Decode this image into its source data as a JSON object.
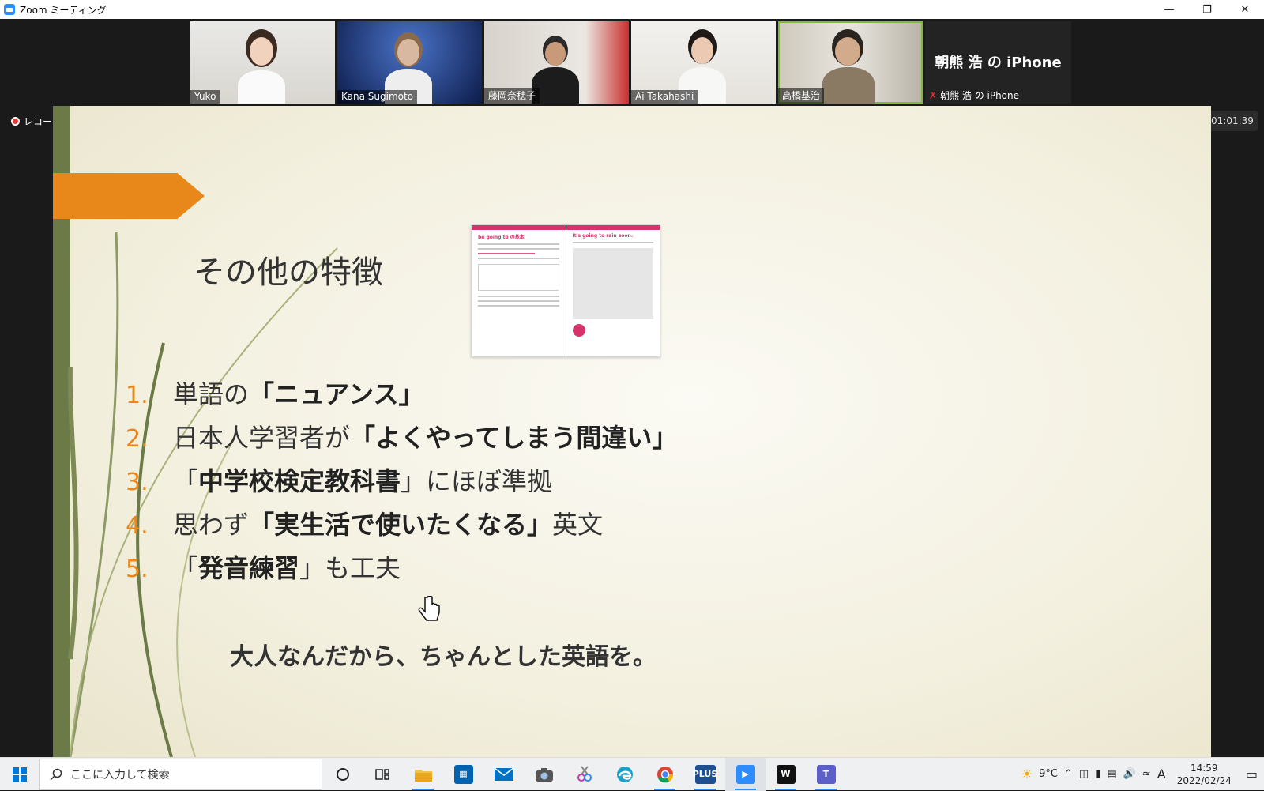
{
  "window": {
    "title": "Zoom ミーティング"
  },
  "participants": [
    {
      "name": "Yuko"
    },
    {
      "name": "Kana Sugimoto"
    },
    {
      "name": "藤岡奈穂子"
    },
    {
      "name": "Ai Takahashi"
    },
    {
      "name": "高橋基治",
      "active": true
    }
  ],
  "no_video_participant": {
    "display_name": "朝熊 浩 の iPhone",
    "label": "朝熊 浩 の iPhone"
  },
  "recording": {
    "label": "レコーディング中"
  },
  "timer": "01:01:39",
  "slide": {
    "title": "その他の特徴",
    "items": [
      {
        "num": "1.",
        "pre": "単語の",
        "bold": "「ニュアンス」",
        "post": ""
      },
      {
        "num": "2.",
        "pre": "日本人学習者が",
        "bold": "「よくやってしまう間違い」",
        "post": ""
      },
      {
        "num": "3.",
        "pre": "「",
        "bold": "中学校検定教科書",
        "post": "」にほぼ準拠"
      },
      {
        "num": "4.",
        "pre": "思わず",
        "bold": "「実生活で使いたくなる」",
        "post": "英文"
      },
      {
        "num": "5.",
        "pre": "「",
        "bold": "発音練習",
        "post": "」も工夫"
      }
    ],
    "slogan": "大人なんだから、ちゃんとした英語を。",
    "book": {
      "left_heading": "be going to の基本",
      "right_heading": "It's going to rain soon."
    }
  },
  "taskbar": {
    "search_placeholder": "ここに入力して検索",
    "weather": "9°C",
    "time": "14:59",
    "date": "2022/02/24",
    "ime": "A"
  },
  "colors": {
    "accent_orange": "#e8881a",
    "zoom_blue": "#2d8cff",
    "active_speaker": "#7fb842",
    "bar_green": "#6b7a47"
  }
}
